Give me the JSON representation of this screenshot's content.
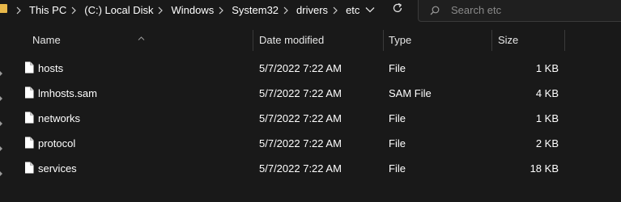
{
  "address_bar": {
    "breadcrumbs": [
      "This PC",
      "(C:) Local Disk",
      "Windows",
      "System32",
      "drivers",
      "etc"
    ]
  },
  "search": {
    "placeholder": "Search etc",
    "value": ""
  },
  "columns": {
    "name": "Name",
    "date_modified": "Date modified",
    "type": "Type",
    "size": "Size"
  },
  "files": [
    {
      "name": "hosts",
      "date_modified": "5/7/2022 7:22 AM",
      "type": "File",
      "size": "1 KB"
    },
    {
      "name": "lmhosts.sam",
      "date_modified": "5/7/2022 7:22 AM",
      "type": "SAM File",
      "size": "4 KB"
    },
    {
      "name": "networks",
      "date_modified": "5/7/2022 7:22 AM",
      "type": "File",
      "size": "1 KB"
    },
    {
      "name": "protocol",
      "date_modified": "5/7/2022 7:22 AM",
      "type": "File",
      "size": "2 KB"
    },
    {
      "name": "services",
      "date_modified": "5/7/2022 7:22 AM",
      "type": "File",
      "size": "18 KB"
    }
  ],
  "icons": {
    "folder": "folder-icon",
    "breadcrumb_separator": "chevron-right-icon",
    "history": "chevron-down-icon",
    "refresh": "refresh-icon",
    "search": "search-icon",
    "file": "file-icon",
    "sort": "sort-ascending-icon"
  },
  "colors": {
    "background": "#191919",
    "text": "#ffffff",
    "placeholder": "#8a8a8a",
    "divider": "#3a3a3a",
    "folder": "#e9b84a"
  }
}
